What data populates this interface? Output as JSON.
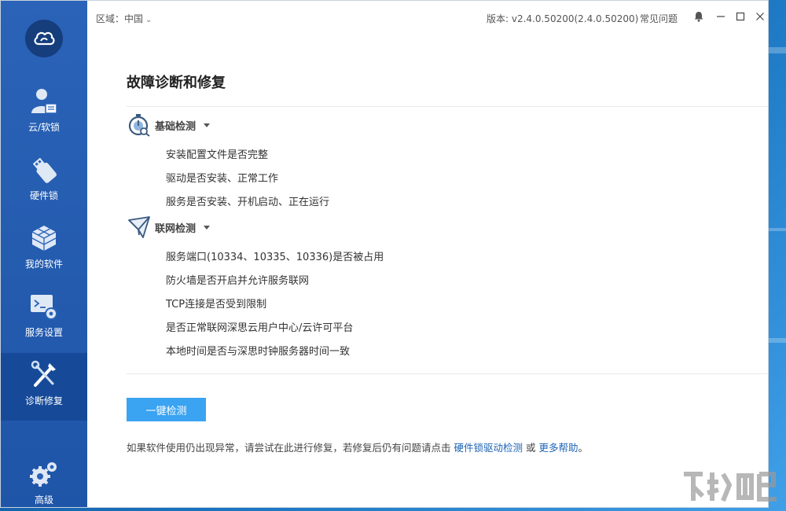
{
  "titlebar": {
    "region_label": "区域：中国",
    "version": "版本: v2.4.0.50200(2.4.0.50200)",
    "faq": "常见问题"
  },
  "sidebar": {
    "items": [
      {
        "label": "云/软锁",
        "icon": "user-license-icon"
      },
      {
        "label": "硬件锁",
        "icon": "usb-dongle-icon"
      },
      {
        "label": "我的软件",
        "icon": "cubes-icon"
      },
      {
        "label": "服务设置",
        "icon": "terminal-gear-icon"
      },
      {
        "label": "诊断修复",
        "icon": "wrench-screwdriver-icon",
        "active": true
      },
      {
        "label": "高级",
        "icon": "gears-icon"
      }
    ]
  },
  "main": {
    "title": "故障诊断和修复",
    "sections": [
      {
        "title": "基础检测",
        "icon": "stopwatch-search-icon",
        "items": [
          "安装配置文件是否完整",
          "驱动是否安装、正常工作",
          "服务是否安装、开机启动、正在运行"
        ]
      },
      {
        "title": "联网检测",
        "icon": "paper-plane-icon",
        "items": [
          "服务端口(10334、10335、10336)是否被占用",
          "防火墙是否开启并允许服务联网",
          "TCP连接是否受到限制",
          "是否正常联网深思云用户中心/云许可平台",
          "本地时间是否与深思时钟服务器时间一致"
        ]
      }
    ],
    "detect_button": "一键检测",
    "footer": {
      "text_before": "如果软件使用仍出现异常，请尝试在此进行修复，若修复后仍有问题请点击",
      "link1": "硬件锁驱动检测",
      "text_middle": "或",
      "link2": "更多帮助",
      "text_after": "。"
    }
  },
  "colors": {
    "sidebar": "#2a63b8",
    "sidebar_active": "#164a99",
    "button": "#3aa3f2",
    "link": "#1d63b5"
  }
}
